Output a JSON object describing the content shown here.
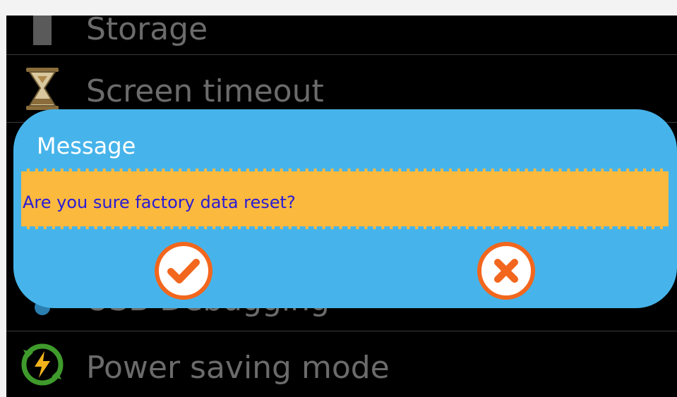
{
  "settings": {
    "items": [
      {
        "label": "Storage",
        "icon": "storage-icon"
      },
      {
        "label": "Screen timeout",
        "icon": "hourglass-icon"
      },
      {
        "label": "USB Debugging",
        "icon": "usb-debugging-icon"
      },
      {
        "label": "Power saving mode",
        "icon": "power-saving-icon"
      }
    ]
  },
  "dialog": {
    "title": "Message",
    "message": "Are you sure factory data reset?",
    "confirm_icon": "check-icon",
    "cancel_icon": "close-icon"
  },
  "colors": {
    "dialog_background": "#46b4ea",
    "message_background": "#fbb93e",
    "message_text": "#2a1bd6",
    "button_accent": "#f2661d",
    "setting_text": "#6b6b6b"
  }
}
